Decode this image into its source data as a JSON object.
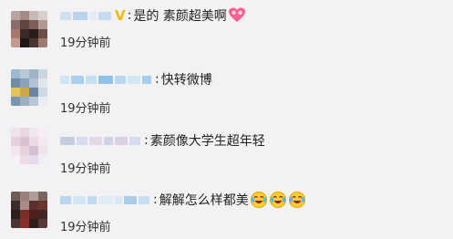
{
  "comments": [
    {
      "separator": ":",
      "content": "是的 素颜超美啊",
      "time": "19分钟前",
      "icons": [
        "verified-v-badge-icon",
        "heart-eyes-emoji-icon"
      ]
    },
    {
      "separator": ":",
      "content": "快转微博",
      "time": "19分钟前",
      "icons": []
    },
    {
      "separator": ":",
      "content": "素颜像大学生超年轻",
      "time": "19分钟前",
      "icons": []
    },
    {
      "separator": ":",
      "content": "解解怎么样都美",
      "time": "19分钟前",
      "icons": [
        "crying-laughing-emoji-icon",
        "crying-laughing-emoji-icon",
        "crying-laughing-emoji-icon"
      ]
    }
  ],
  "colors": {
    "background": "#f2f2f4",
    "text": "#222222",
    "verified_badge": "#f5b800"
  }
}
